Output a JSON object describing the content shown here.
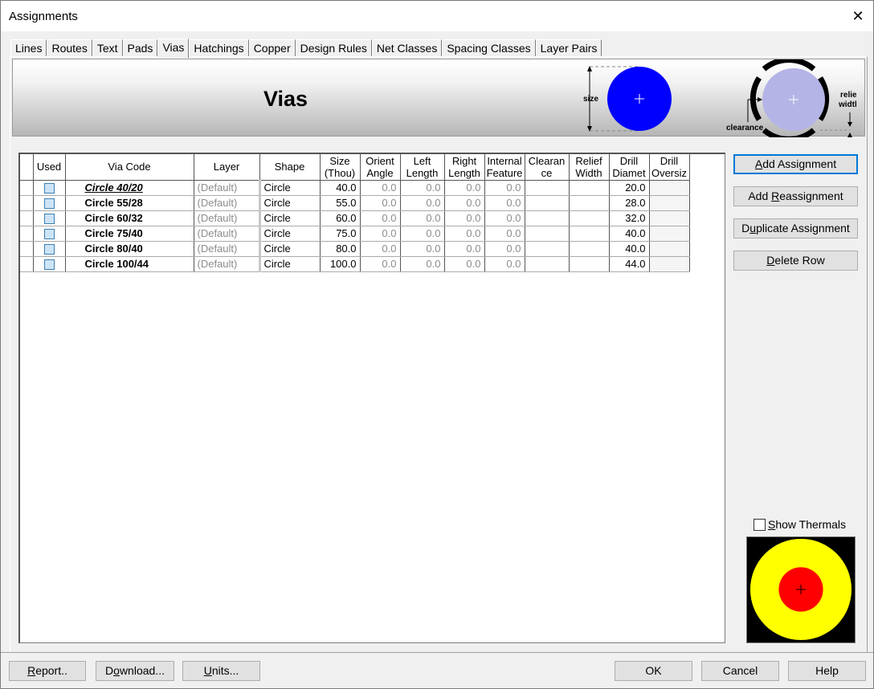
{
  "window": {
    "title": "Assignments"
  },
  "tabs": [
    {
      "label": "Lines"
    },
    {
      "label": "Routes"
    },
    {
      "label": "Text"
    },
    {
      "label": "Pads"
    },
    {
      "label": "Vias",
      "active": true
    },
    {
      "label": "Hatchings"
    },
    {
      "label": "Copper"
    },
    {
      "label": "Design Rules"
    },
    {
      "label": "Net Classes"
    },
    {
      "label": "Spacing Classes"
    },
    {
      "label": "Layer Pairs"
    }
  ],
  "banner": {
    "title": "Vias",
    "size_label": "size",
    "relief_label_1": "relief",
    "relief_label_2": "width",
    "clearance_label": "clearance"
  },
  "colors": {
    "via_fill": "#0000ff",
    "relief_fill": "#b4b4e6",
    "thermal_outer": "#ffff00",
    "thermal_inner": "#ff0000",
    "thermal_bg": "#000000",
    "default_button_border": "#0078d7"
  },
  "grid": {
    "columns": [
      {
        "l1": "Used",
        "l2": ""
      },
      {
        "l1": "Via Code",
        "l2": ""
      },
      {
        "l1": "Layer",
        "l2": ""
      },
      {
        "l1": "Shape",
        "l2": ""
      },
      {
        "l1": "Size",
        "l2": "(Thou)"
      },
      {
        "l1": "Orient",
        "l2": "Angle"
      },
      {
        "l1": "Left",
        "l2": "Length"
      },
      {
        "l1": "Right",
        "l2": "Length"
      },
      {
        "l1": "Internal",
        "l2": "Feature"
      },
      {
        "l1": "Clearan",
        "l2": "ce"
      },
      {
        "l1": "Relief",
        "l2": "Width"
      },
      {
        "l1": "Drill",
        "l2": "Diamet"
      },
      {
        "l1": "Drill",
        "l2": "Oversiz"
      }
    ],
    "rows": [
      {
        "code": "Circle 40/20",
        "layer": "(Default)",
        "shape": "Circle",
        "size": "40.0",
        "orient": "0.0",
        "left": "0.0",
        "right": "0.0",
        "internal": "0.0",
        "clearance": "",
        "relief": "",
        "drill": "20.0",
        "oversize": ""
      },
      {
        "code": "Circle 55/28",
        "layer": "(Default)",
        "shape": "Circle",
        "size": "55.0",
        "orient": "0.0",
        "left": "0.0",
        "right": "0.0",
        "internal": "0.0",
        "clearance": "",
        "relief": "",
        "drill": "28.0",
        "oversize": ""
      },
      {
        "code": "Circle 60/32",
        "layer": "(Default)",
        "shape": "Circle",
        "size": "60.0",
        "orient": "0.0",
        "left": "0.0",
        "right": "0.0",
        "internal": "0.0",
        "clearance": "",
        "relief": "",
        "drill": "32.0",
        "oversize": ""
      },
      {
        "code": "Circle 75/40",
        "layer": "(Default)",
        "shape": "Circle",
        "size": "75.0",
        "orient": "0.0",
        "left": "0.0",
        "right": "0.0",
        "internal": "0.0",
        "clearance": "",
        "relief": "",
        "drill": "40.0",
        "oversize": ""
      },
      {
        "code": "Circle 80/40",
        "layer": "(Default)",
        "shape": "Circle",
        "size": "80.0",
        "orient": "0.0",
        "left": "0.0",
        "right": "0.0",
        "internal": "0.0",
        "clearance": "",
        "relief": "",
        "drill": "40.0",
        "oversize": ""
      },
      {
        "code": "Circle 100/44",
        "layer": "(Default)",
        "shape": "Circle",
        "size": "100.0",
        "orient": "0.0",
        "left": "0.0",
        "right": "0.0",
        "internal": "0.0",
        "clearance": "",
        "relief": "",
        "drill": "44.0",
        "oversize": ""
      }
    ]
  },
  "side_buttons": {
    "add_assignment": {
      "pre": "",
      "key": "A",
      "post": "dd Assignment"
    },
    "add_reassignment": {
      "pre": "Add ",
      "key": "R",
      "post": "eassignment"
    },
    "duplicate_assignment": {
      "pre": "D",
      "key": "u",
      "post": "plicate Assignment"
    },
    "delete_row": {
      "pre": "",
      "key": "D",
      "post": "elete Row"
    }
  },
  "show_thermals": {
    "label_key": "S",
    "label_rest": "how Thermals",
    "checked": false
  },
  "footer": {
    "report": {
      "pre": "",
      "key": "R",
      "post": "eport.."
    },
    "download": {
      "pre": "D",
      "key": "o",
      "post": "wnload..."
    },
    "units": {
      "pre": "",
      "key": "U",
      "post": "nits..."
    },
    "ok": "OK",
    "cancel": "Cancel",
    "help": "Help"
  }
}
